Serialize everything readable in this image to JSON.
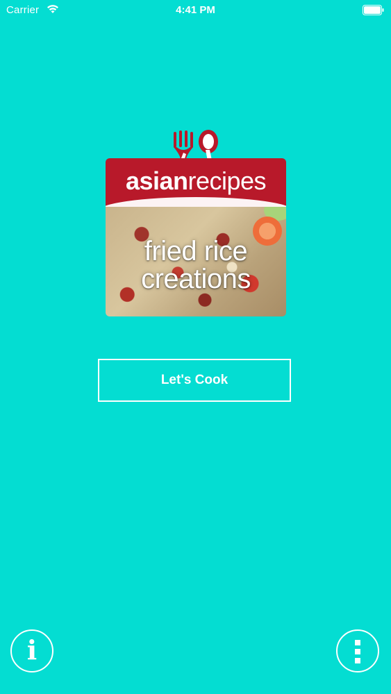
{
  "status_bar": {
    "carrier": "Carrier",
    "time": "4:41 PM",
    "wifi_icon": "wifi-icon",
    "battery_icon": "battery-icon"
  },
  "logo": {
    "brand_part1": "asian",
    "brand_part2": "recipes",
    "title_line1": "fried rice",
    "title_line2": "creations",
    "icon": "fork-spoon-icon",
    "header_color": "#B8192A"
  },
  "cta": {
    "label": "Let's Cook"
  },
  "bottom_bar": {
    "info_icon": "info-icon",
    "info_glyph": "i",
    "more_icon": "more-vertical-icon"
  },
  "theme": {
    "background": "#04DDD2",
    "foreground": "#FFFFFF"
  }
}
